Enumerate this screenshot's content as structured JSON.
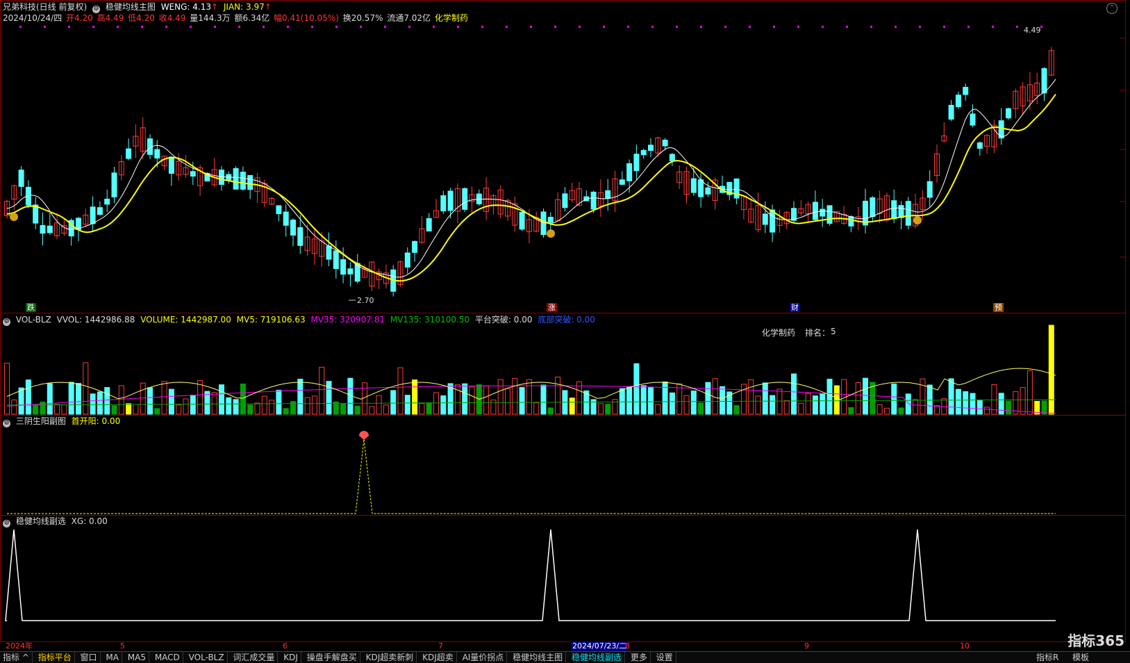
{
  "header": {
    "stock_name": "兄弟科技(日线 前复权)",
    "main_indicator": "稳健均线主图",
    "weng": "WENG: 4.13",
    "jian": "JIAN: 3.97",
    "date": "2024/10/24/四",
    "open": "开4.20",
    "high": "高4.49",
    "low": "低4.20",
    "close": "收4.49",
    "volume": "量144.3万",
    "amount": "额6.34亿",
    "change": "幅0.41(10.05%)",
    "turnover": "换20.57%",
    "float": "流通7.02亿",
    "sector": "化学制药"
  },
  "price_panel": {
    "high_label": "4.49",
    "low_label": "2.70",
    "markers": [
      "跌",
      "涨",
      "财",
      "预"
    ]
  },
  "volume_panel": {
    "name": "VOL-BLZ",
    "vvol": "VVOL: 1442986.88",
    "volume": "VOLUME: 1442987.00",
    "mv5": "MV5: 719106.63",
    "mv35": "MV35: 320907.81",
    "mv135": "MV135: 310100.50",
    "platform": "平台突破: 0.00",
    "heavy": "底部突破: 0.00",
    "sector_label": "化学制药",
    "rank_label": "排名：",
    "rank_value": "5"
  },
  "sub1": {
    "name": "三阴生阳副图",
    "field": "首开阳: 0.00"
  },
  "sub2": {
    "name": "稳健均线副选",
    "field": "XG: 0.00"
  },
  "xaxis": {
    "labels": [
      "2024年",
      "5",
      "6",
      "7",
      "2024/07/23/二",
      "8",
      "9",
      "10"
    ]
  },
  "tabs": [
    "指标 ^",
    "指标平台",
    "窗口",
    "MA",
    "MA5",
    "MACD",
    "VOL-BLZ",
    "词汇成交量",
    "KDJ",
    "操盘手解盘买",
    "KDJ超卖新刺",
    "KDJ超卖",
    "AI量价拐点",
    "稳健均线主图",
    "稳健均线副选",
    "更多",
    "设置",
    "指标R",
    "模板"
  ],
  "logo": "指标365",
  "colors": {
    "up": "#ff3b3b",
    "down": "#54ffff",
    "ma_white": "#ffffff",
    "ma_yellow": "#ffff00",
    "mv35": "#ff00ff",
    "mv135": "#00a000"
  }
}
